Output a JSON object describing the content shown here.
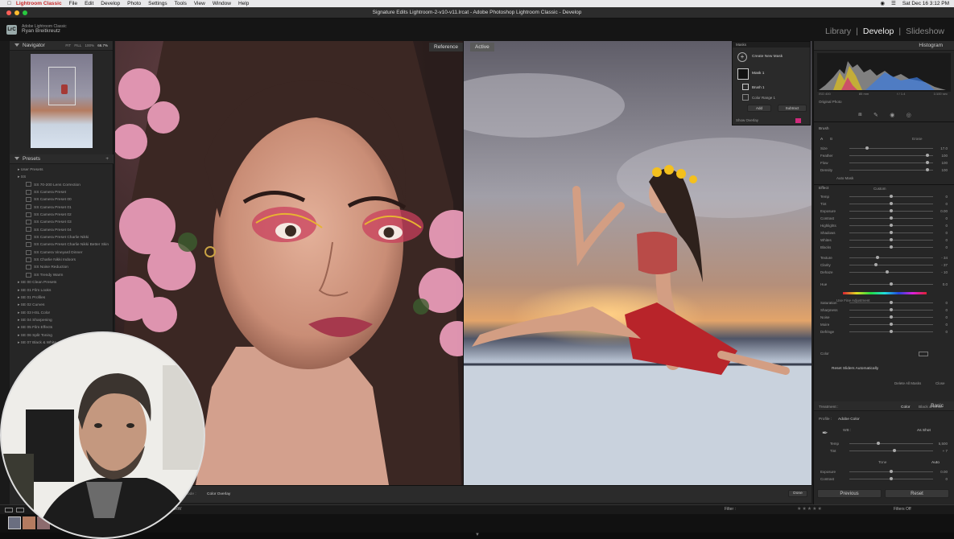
{
  "menubar": {
    "app": "Lightroom Classic",
    "items": [
      "File",
      "Edit",
      "Develop",
      "Photo",
      "Settings",
      "Tools",
      "View",
      "Window",
      "Help"
    ],
    "clock": "Sat Dec 16  3:12 PM"
  },
  "window": {
    "title": "Signature Edits Lightroom-2-v10-v11.lrcat - Adobe Photoshop Lightroom Classic - Develop"
  },
  "identity": {
    "logo": "LrC",
    "line1": "Adobe Lightroom Classic",
    "name": "Ryan Breitkreutz"
  },
  "modules": {
    "library": "Library",
    "develop": "Develop",
    "slideshow": "Slideshow",
    "sep": "|"
  },
  "navigator": {
    "title": "Navigator",
    "zoom_options": [
      "FIT",
      "FILL",
      "100%",
      "66.7%"
    ]
  },
  "presets": {
    "title": "Presets",
    "groups": [
      {
        "label": "User Presets",
        "kind": "grp"
      },
      {
        "label": "SS",
        "kind": "grp"
      },
      {
        "label": "SS 70-200 Lens Correction",
        "kind": "sub"
      },
      {
        "label": "SS Camera Preset",
        "kind": "sub"
      },
      {
        "label": "SS Camera Preset 00",
        "kind": "sub"
      },
      {
        "label": "SS Camera Preset 01",
        "kind": "sub"
      },
      {
        "label": "SS Camera Preset 02",
        "kind": "sub"
      },
      {
        "label": "SS Camera Preset 03",
        "kind": "sub"
      },
      {
        "label": "SS Camera Preset 04",
        "kind": "sub"
      },
      {
        "label": "SS Camera Preset Charlie Nikki",
        "kind": "sub"
      },
      {
        "label": "SS Camera Preset Charlie Nikki Better Skin",
        "kind": "sub"
      },
      {
        "label": "SS Camera Vineyard Dinner",
        "kind": "sub"
      },
      {
        "label": "SS Charlie Nikki Indoors",
        "kind": "sub"
      },
      {
        "label": "SS Noise Reduction",
        "kind": "sub"
      },
      {
        "label": "SS Trendy Warm",
        "kind": "sub"
      },
      {
        "label": "SE 00 Clean Presets",
        "kind": "grp"
      },
      {
        "label": "SE 01 Film Looks",
        "kind": "grp"
      },
      {
        "label": "SE 01 Profiles",
        "kind": "grp"
      },
      {
        "label": "SE 02 Curves",
        "kind": "grp"
      },
      {
        "label": "SE 03 HSL Color",
        "kind": "grp"
      },
      {
        "label": "SE 04 Sharpening",
        "kind": "grp"
      },
      {
        "label": "SE 05 Film Effects",
        "kind": "grp"
      },
      {
        "label": "SE 06 Split Toning",
        "kind": "grp"
      },
      {
        "label": "SE 07 Black & White",
        "kind": "grp"
      }
    ]
  },
  "view": {
    "reference_label": "Reference",
    "active_label": "Active"
  },
  "masks": {
    "title": "Masks",
    "create": "Create New Mask",
    "mask1": "Mask 1",
    "brush": "Brush 1",
    "range": "Color Range 1",
    "add": "Add",
    "subtract": "Subtract",
    "overlay": "Show Overlay"
  },
  "histogram": {
    "title": "Histogram",
    "left_info": "ISO 400",
    "mid_info": "85 mm",
    "right_info": "f / 1.4",
    "shutter": "1/100 sec",
    "original_photo": "Original Photo"
  },
  "brush": {
    "label": "Brush",
    "erase": "Erase",
    "ab": [
      "A",
      "B"
    ],
    "rows": [
      {
        "name": "Size",
        "pos": 0.2,
        "val": "17.0"
      },
      {
        "name": "Feather",
        "pos": 0.95,
        "val": "100"
      },
      {
        "name": "Flow",
        "pos": 0.95,
        "val": "100"
      },
      {
        "name": "Density",
        "pos": 0.95,
        "val": "100"
      }
    ],
    "automask": "Auto Mask"
  },
  "effect": {
    "label": "Effect",
    "custom": "Custom",
    "rows": [
      {
        "name": "Temp",
        "pos": 0.5,
        "val": "0"
      },
      {
        "name": "Tint",
        "pos": 0.5,
        "val": "0"
      },
      {
        "name": "Exposure",
        "pos": 0.5,
        "val": "0.00"
      },
      {
        "name": "Contrast",
        "pos": 0.5,
        "val": "0"
      },
      {
        "name": "Highlights",
        "pos": 0.5,
        "val": "0"
      },
      {
        "name": "Shadows",
        "pos": 0.5,
        "val": "0"
      },
      {
        "name": "Whites",
        "pos": 0.5,
        "val": "0"
      },
      {
        "name": "Blacks",
        "pos": 0.5,
        "val": "0"
      },
      {
        "name": "Texture",
        "pos": 0.33,
        "val": "- 34"
      },
      {
        "name": "Clarity",
        "pos": 0.31,
        "val": "- 37"
      },
      {
        "name": "Dehaze",
        "pos": 0.45,
        "val": "- 10"
      },
      {
        "name": "Hue",
        "pos": 0.5,
        "val": "0.0"
      },
      {
        "name": "Saturation",
        "pos": 0.5,
        "val": "0"
      },
      {
        "name": "Sharpness",
        "pos": 0.5,
        "val": "0"
      },
      {
        "name": "Noise",
        "pos": 0.5,
        "val": "0"
      },
      {
        "name": "Moire",
        "pos": 0.5,
        "val": "0"
      },
      {
        "name": "Defringe",
        "pos": 0.5,
        "val": "0"
      }
    ],
    "fine_adjust": "Use Fine Adjustment",
    "color": "Color",
    "reset_sliders": "Reset Sliders Automatically",
    "delete_all": "Delete All Masks",
    "close": "Close"
  },
  "basic": {
    "title": "Basic",
    "treatment": "Treatment :",
    "color": "Color",
    "bw": "Black & White",
    "profile_label": "Profile :",
    "profile": "Adobe Color",
    "wb_label": "WB :",
    "wb": "As Shot",
    "temp": "Temp",
    "temp_val": "5,500",
    "tint": "Tint",
    "tint_val": "+ 7",
    "tone": "Tone",
    "auto": "Auto",
    "exposure": "Exposure",
    "exposure_val": "0.00",
    "contrast": "Contrast",
    "contrast_val": "0"
  },
  "footer": {
    "mode_label": "Mode :",
    "mode": "Color Overlay",
    "done": "Done",
    "previous": "Previous",
    "reset": "Reset",
    "filter": "Filter :",
    "filters_off": "Filters Off",
    "file_suffix": "c.ARW"
  },
  "colors": {
    "accent_magenta": "#d02a7c",
    "panel_bg": "#262626"
  }
}
